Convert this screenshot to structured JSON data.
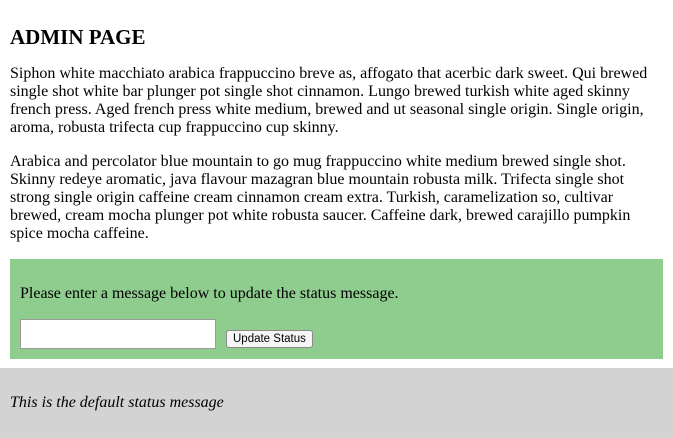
{
  "page": {
    "title": "ADMIN PAGE"
  },
  "paragraphs": [
    "Siphon white macchiato arabica frappuccino breve as, affogato that acerbic dark sweet. Qui brewed single shot white bar plunger pot single shot cinnamon. Lungo brewed turkish white aged skinny french press. Aged french press white medium, brewed and ut seasonal single origin. Single origin, aroma, robusta trifecta cup frappuccino cup skinny.",
    "Arabica and percolator blue mountain to go mug frappuccino white medium brewed single shot. Skinny redeye aromatic, java flavour mazagran blue mountain robusta milk. Trifecta single shot strong single origin caffeine cream cinnamon cream extra. Turkish, caramelization so, cultivar brewed, cream mocha plunger pot white robusta saucer. Caffeine dark, brewed carajillo pumpkin spice mocha caffeine."
  ],
  "status_form": {
    "prompt": "Please enter a message below to update the status message.",
    "input_value": "",
    "button_label": "Update Status",
    "background_color": "#8fcd8f"
  },
  "status_bar": {
    "message": "This is the default status message",
    "background_color": "#d3d3d3"
  }
}
